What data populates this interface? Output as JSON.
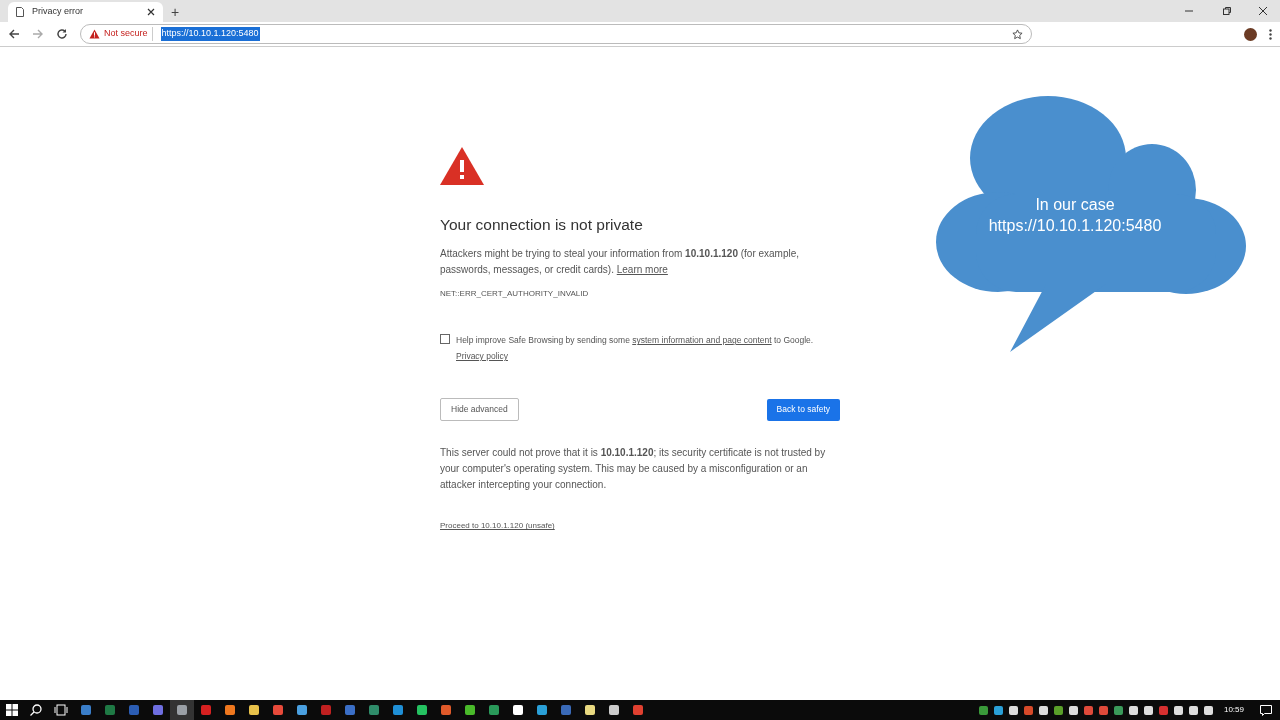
{
  "tab": {
    "title": "Privacy error",
    "selected": true
  },
  "new_tab": "+",
  "address_bar": {
    "security": "Not secure",
    "url": "https://10.10.1.120:5480",
    "url_selected": true
  },
  "page": {
    "heading": "Your connection is not private",
    "message": {
      "text": "Attackers might be trying to steal your information from **10.10.1.120** (for example, passwords, messages, or credit cards).",
      "link": "Learn more"
    },
    "error_code": "NET::ERR_CERT_AUTHORITY_INVALID",
    "report": {
      "checked": false,
      "text_1": "Help improve Safe Browsing by sending some",
      "link_1": "system information and page content",
      "text_2": "to Google.",
      "link_2": "Privacy policy"
    },
    "secondary_button": "Hide advanced",
    "primary_button": "Back to safety",
    "details": "This server could not prove that it is **10.10.1.120**; its security certificate is not trusted by your computer's operating system. This may be caused by a misconfiguration or an attacker intercepting your connection.",
    "proceed_link": "Proceed to 10.10.1.120 (unsafe)"
  },
  "callout": {
    "lines": [
      "In our case",
      "https://10.10.1.120:5480"
    ]
  },
  "taskbar": {
    "clock": "10:59"
  }
}
